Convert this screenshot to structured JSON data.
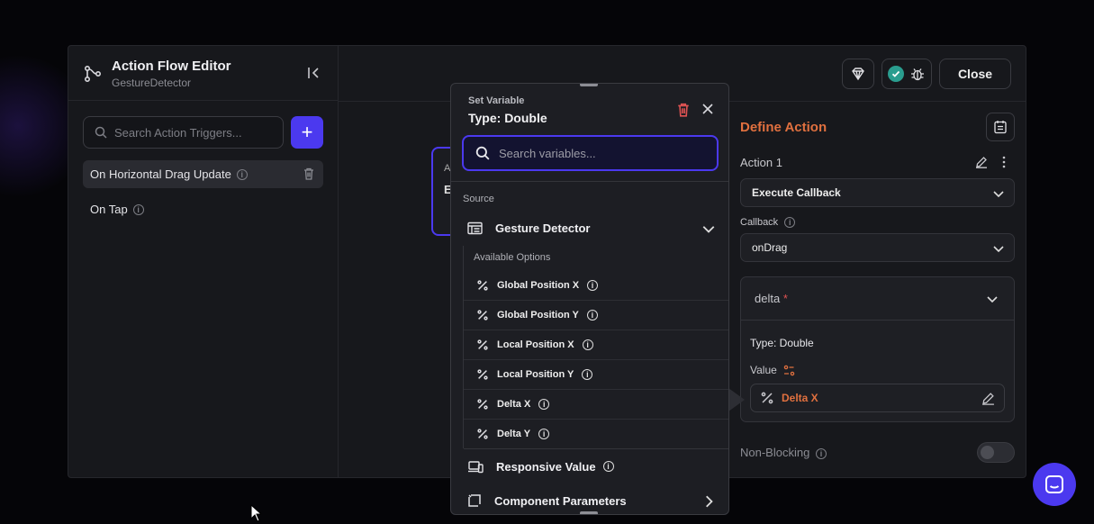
{
  "editor": {
    "title": "Action Flow Editor",
    "subtitle": "GestureDetector",
    "search_placeholder": "Search Action Triggers...",
    "add_label": "+",
    "triggers": [
      {
        "label": "On Horizontal Drag Update",
        "active": true
      },
      {
        "label": "On Tap",
        "active": false
      }
    ],
    "close_label": "Close",
    "node_letters": [
      "A",
      "E"
    ]
  },
  "define_action": {
    "title": "Define Action",
    "action_label": "Action 1",
    "action_type": "Execute Callback",
    "callback_label": "Callback",
    "callback_value": "onDrag",
    "param_name": "delta",
    "param_required_mark": "*",
    "param_type": "Type: Double",
    "value_label": "Value",
    "value": "Delta X",
    "non_blocking_label": "Non-Blocking"
  },
  "popup": {
    "kicker": "Set Variable",
    "title": "Type: Double",
    "search_placeholder": "Search variables...",
    "source_label": "Source",
    "source_group": "Gesture Detector",
    "options_heading": "Available Options",
    "options": [
      "Global Position X",
      "Global Position Y",
      "Local Position X",
      "Local Position Y",
      "Delta X",
      "Delta Y"
    ],
    "groups": [
      "Responsive Value",
      "Component Parameters"
    ]
  },
  "colors": {
    "accent": "#4b39ef",
    "orange": "#e0703f",
    "success": "#2a9d8f",
    "danger": "#e05353"
  }
}
